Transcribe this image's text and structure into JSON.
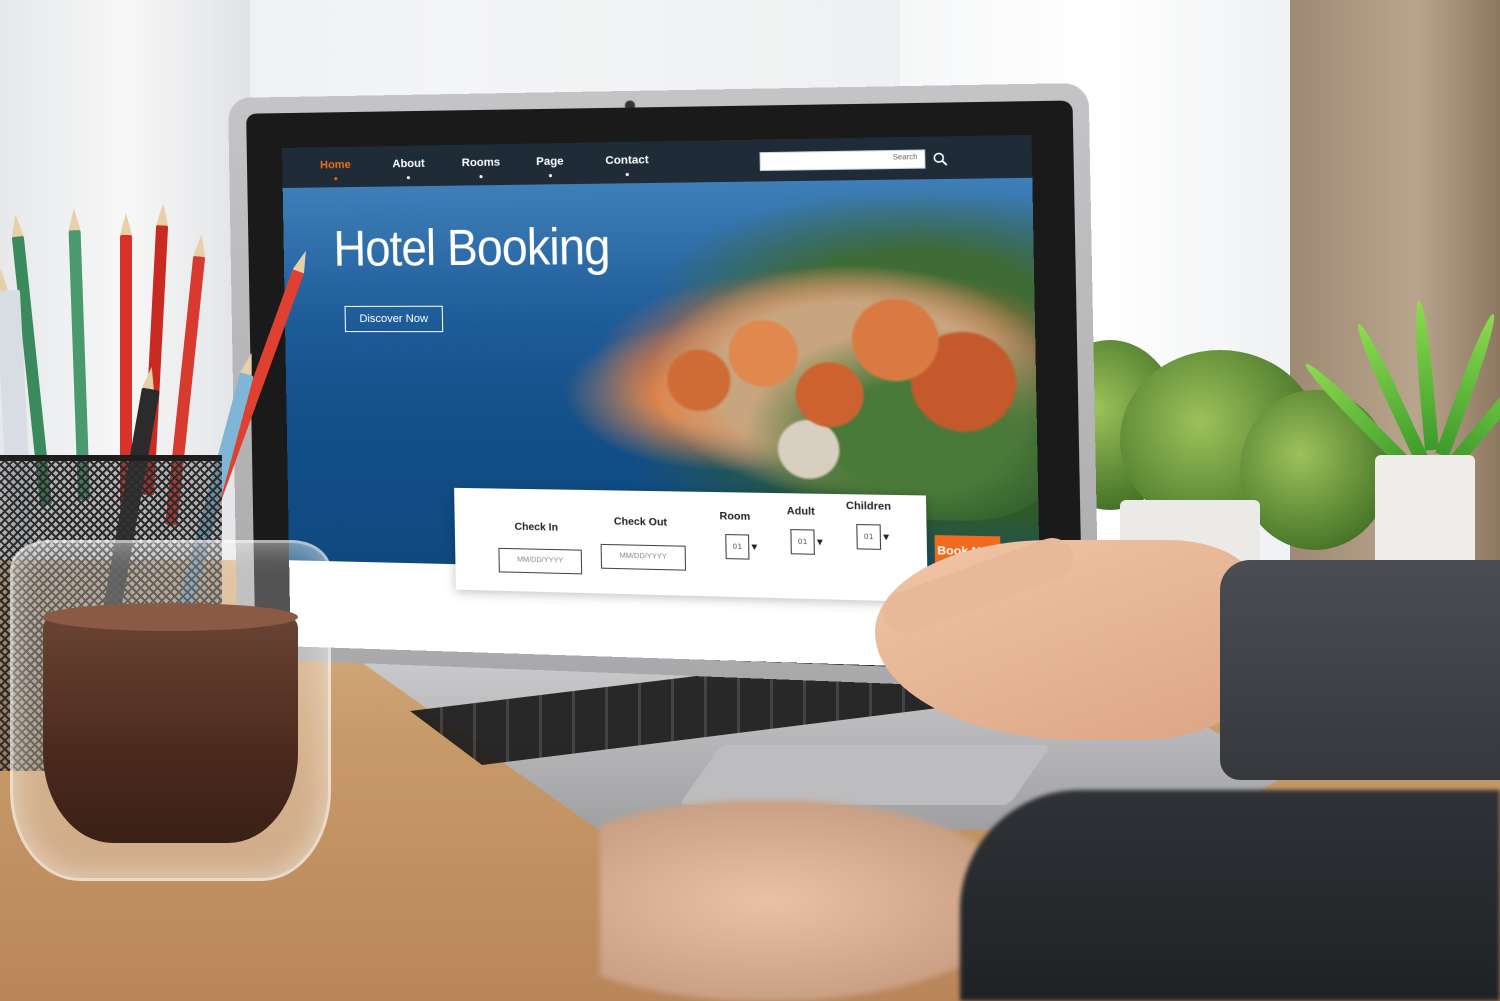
{
  "nav": {
    "items": [
      {
        "label": "Home",
        "active": true
      },
      {
        "label": "About",
        "active": false
      },
      {
        "label": "Rooms",
        "active": false
      },
      {
        "label": "Page",
        "active": false
      },
      {
        "label": "Contact",
        "active": false
      }
    ],
    "search": {
      "label": "Search",
      "icon": "search-icon"
    }
  },
  "hero": {
    "title": "Hotel Booking",
    "discover_label": "Discover Now"
  },
  "booking": {
    "check_in": {
      "label": "Check In",
      "placeholder": "MM/DD/YYYY"
    },
    "check_out": {
      "label": "Check Out",
      "placeholder": "MM/DD/YYYY"
    },
    "room": {
      "label": "Room",
      "value": "01"
    },
    "adult": {
      "label": "Adult",
      "value": "01"
    },
    "children": {
      "label": "Children",
      "value": "01"
    },
    "book_label": "Book Now"
  },
  "colors": {
    "accent": "#f26a1b",
    "navbar": "#1f2b37",
    "text_light": "#ffffff"
  }
}
